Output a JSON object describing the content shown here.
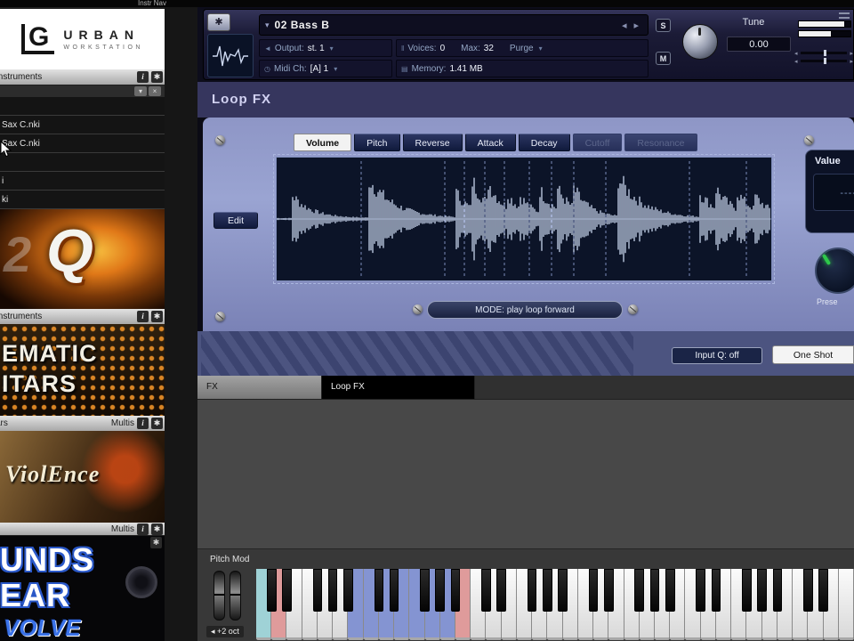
{
  "topbar": {
    "nav_label": "Instr Nav"
  },
  "icons": {
    "gear": "✱",
    "info": "i",
    "dropdown": "▾",
    "close": "×",
    "arrow_left": "◂",
    "arrow_right": "▸",
    "speaker": "◄",
    "voices": "‖",
    "clock": "◷",
    "memory": "▤",
    "collapse": "▾"
  },
  "sidebar": {
    "logo": {
      "letter": "G",
      "brand": "URBAN",
      "sub": "WORKSTATION"
    },
    "instruments_tab": "Instruments",
    "files": [
      "",
      "Sax C.nki",
      "Sax C.nki",
      "",
      "i",
      "ki"
    ],
    "q_library": {
      "num": "2",
      "letter": "Q",
      "tab_left": "Instruments",
      "tab_right": ""
    },
    "cinematic_library": {
      "line1": "EMATIC",
      "line2": "ITARS",
      "tab_left": "ars",
      "tab_right": "Multis"
    },
    "violence_library": {
      "title": "ViolEnce",
      "tab_left": "",
      "tab_right": "Multis"
    },
    "sounds_library": {
      "line1": "UNDS",
      "line2": "EAR",
      "badge": "VOLVE"
    }
  },
  "header": {
    "title": "02 Bass B",
    "output_label": "Output:",
    "output_value": "st. 1",
    "voices_label": "Voices:",
    "voices_value": "0",
    "max_label": "Max:",
    "max_value": "32",
    "purge_label": "Purge",
    "midi_label": "Midi Ch:",
    "midi_value": "[A] 1",
    "memory_label": "Memory:",
    "memory_value": "1.41 MB",
    "tune_label": "Tune",
    "tune_value": "0.00",
    "solo_label": "S",
    "mute_label": "M"
  },
  "loopfx": {
    "title": "Loop FX",
    "tabs": [
      {
        "label": "Volume",
        "state": "active"
      },
      {
        "label": "Pitch",
        "state": "normal"
      },
      {
        "label": "Reverse",
        "state": "normal"
      },
      {
        "label": "Attack",
        "state": "normal"
      },
      {
        "label": "Decay",
        "state": "normal"
      },
      {
        "label": "Cutoff",
        "state": "disabled"
      },
      {
        "label": "Resonance",
        "state": "disabled"
      }
    ],
    "edit_label": "Edit",
    "mode_label": "MODE: play loop forward",
    "value_label": "Value",
    "value_display": "-----",
    "preset_label": "Prese",
    "input_q_label": "Input Q: off",
    "one_shot_label": "One Shot"
  },
  "bottom_tabs": [
    {
      "label": "FX",
      "active": false
    },
    {
      "label": "Loop FX",
      "active": true
    }
  ],
  "keyboard": {
    "pitch_mod_label": "Pitch Mod",
    "octave_label": "+2 oct",
    "white_key_count": 39,
    "colored_keys": {
      "0": "#9fd2d6",
      "1": "#df9b9b",
      "6": "#8494d2",
      "7": "#8494d2",
      "8": "#8494d2",
      "9": "#8494d2",
      "10": "#8494d2",
      "11": "#8494d2",
      "12": "#8494d2",
      "13": "#df9b9b"
    }
  },
  "waveform": {
    "peaks": [
      {
        "x": 0.03,
        "a": 0.5,
        "d": 26
      },
      {
        "x": 0.185,
        "a": 0.85,
        "d": 20
      },
      {
        "x": 0.36,
        "a": 0.55,
        "d": 30
      },
      {
        "x": 0.395,
        "a": 0.6,
        "d": 30
      },
      {
        "x": 0.425,
        "a": 0.5,
        "d": 32
      },
      {
        "x": 0.465,
        "a": 0.3,
        "d": 34
      },
      {
        "x": 0.49,
        "a": 0.27,
        "d": 34
      },
      {
        "x": 0.53,
        "a": 0.5,
        "d": 30
      },
      {
        "x": 0.565,
        "a": 0.45,
        "d": 30
      },
      {
        "x": 0.6,
        "a": 0.4,
        "d": 30
      },
      {
        "x": 0.69,
        "a": 0.82,
        "d": 20
      },
      {
        "x": 0.855,
        "a": 0.5,
        "d": 28
      },
      {
        "x": 0.885,
        "a": 0.45,
        "d": 28
      },
      {
        "x": 0.93,
        "a": 0.36,
        "d": 30
      },
      {
        "x": 0.965,
        "a": 0.3,
        "d": 30
      }
    ],
    "slices": [
      0.17,
      0.34,
      0.38,
      0.42,
      0.46,
      0.51,
      0.555,
      0.6,
      0.665,
      0.835,
      0.95
    ]
  },
  "colors": {
    "panel_top": "#8e96c6",
    "panel_mid": "#9aa4d2",
    "panel_bottom": "#7a82b6",
    "navy_button": "#1a2446",
    "active_tab": "#f2f2f2",
    "waveform_bg": "#0c1428",
    "waveform_line": "#c6d2ea",
    "green_indicator": "#2ec84a",
    "stripe_base": "#4c5480",
    "stripe_dark": "#3c4470"
  }
}
